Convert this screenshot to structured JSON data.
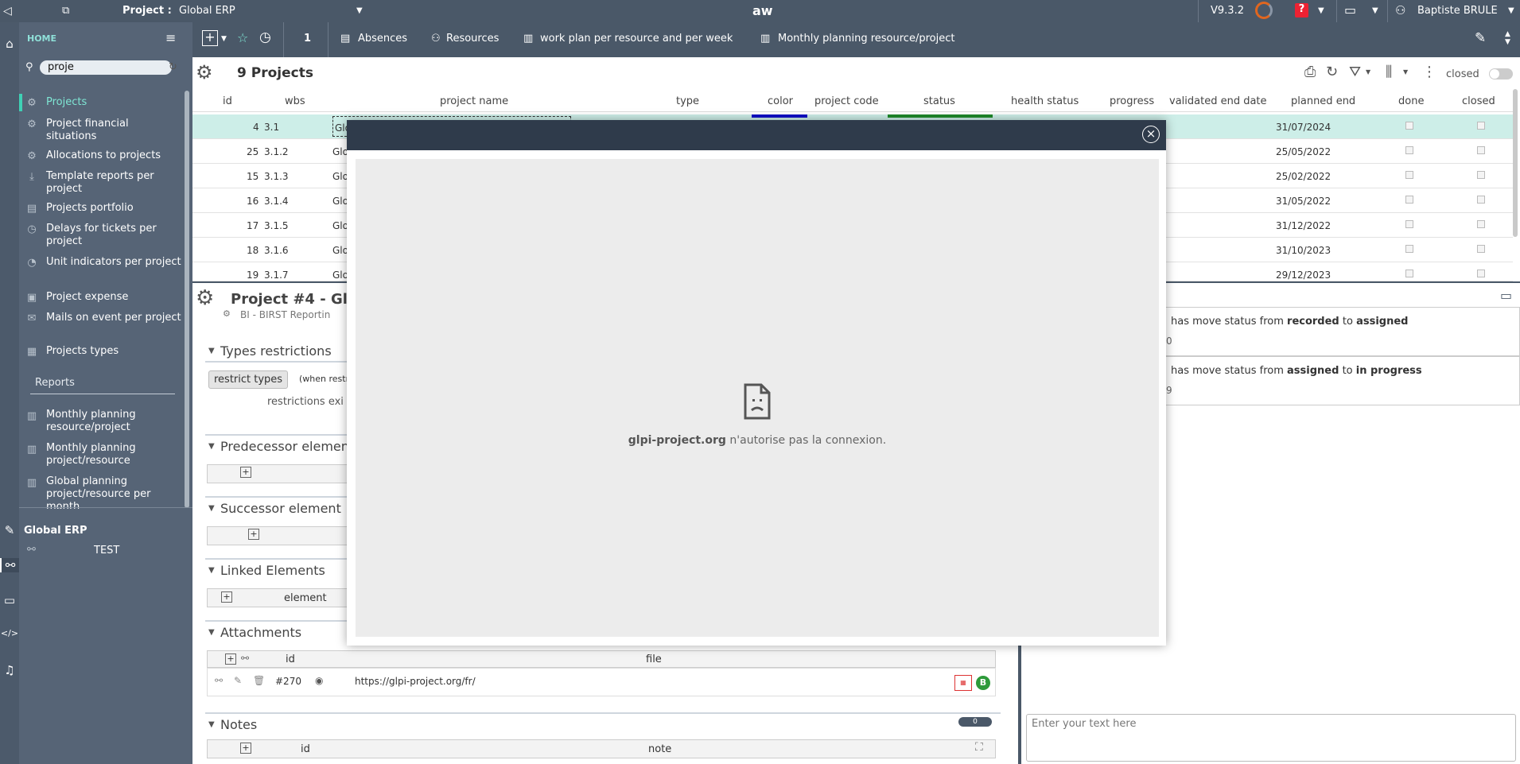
{
  "topbar": {
    "project_label": "Project :",
    "project_value": "Global ERP",
    "center_title": "aw",
    "version": "V9.3.2",
    "user": "Baptiste BRULE"
  },
  "sidebar": {
    "home": "HOME",
    "search_value": "proje",
    "items": [
      {
        "label": "Projects",
        "icon": "gear-icon"
      },
      {
        "label": "Project financial situations",
        "icon": "gear-icon"
      },
      {
        "label": "Allocations to projects",
        "icon": "gear-icon"
      },
      {
        "label": "Template reports per project",
        "icon": "download-icon"
      },
      {
        "label": "Projects portfolio",
        "icon": "portfolio-icon"
      },
      {
        "label": "Delays for tickets per project",
        "icon": "clock-icon"
      },
      {
        "label": "Unit indicators per project",
        "icon": "gauge-icon"
      },
      {
        "label": "Project expense",
        "icon": "expense-icon"
      },
      {
        "label": "Mails on event per project",
        "icon": "mail-icon"
      },
      {
        "label": "Projects types",
        "icon": "types-icon"
      }
    ],
    "reports_header": "Reports",
    "reports": [
      {
        "label": "Monthly planning resource/project"
      },
      {
        "label": "Monthly planning project/resource"
      },
      {
        "label": "Global planning project/resource per month"
      }
    ],
    "footer_project": "Global ERP",
    "footer_sub": "TEST"
  },
  "toolbar": {
    "count": "1",
    "absences": "Absences",
    "resources": "Resources",
    "workplan": "work plan per resource and per week",
    "monthly": "Monthly planning resource/project"
  },
  "list": {
    "title": "9 Projects",
    "closed_label": "closed",
    "columns": [
      "id",
      "wbs",
      "project name",
      "type",
      "color",
      "project code",
      "status",
      "health status",
      "progress",
      "validated end date",
      "planned end",
      "done",
      "closed"
    ],
    "rows": [
      {
        "id": "4",
        "wbs": "3.1",
        "name": "Glo",
        "planned_end": "31/07/2024"
      },
      {
        "id": "25",
        "wbs": "3.1.2",
        "name": "Glo",
        "planned_end": "25/05/2022"
      },
      {
        "id": "15",
        "wbs": "3.1.3",
        "name": "Glo",
        "planned_end": "25/02/2022"
      },
      {
        "id": "16",
        "wbs": "3.1.4",
        "name": "Glo",
        "planned_end": "31/05/2022"
      },
      {
        "id": "17",
        "wbs": "3.1.5",
        "name": "Glo",
        "planned_end": "31/12/2022"
      },
      {
        "id": "18",
        "wbs": "3.1.6",
        "name": "Glo",
        "planned_end": "31/10/2023"
      },
      {
        "id": "19",
        "wbs": "3.1.7",
        "name": "Glo",
        "planned_end": "29/12/2023"
      }
    ]
  },
  "detail": {
    "title": "Project  #4  - Gl",
    "bi_line": "BI - BIRST Reportin",
    "types_restrictions": "Types restrictions",
    "restrict_types": "restrict types",
    "when_restr": "(when restr",
    "restrictions_exi": "restrictions exi",
    "predecessor": "Predecessor elemen",
    "successor": "Successor element",
    "linked": "Linked Elements",
    "linked_col": "element",
    "attachments": "Attachments",
    "att_col_id": "id",
    "att_col_file": "file",
    "att_id": "#270",
    "att_url": "https://glpi-project.org/fr/",
    "notes": "Notes",
    "notes_count": "0",
    "notes_col_id": "id",
    "notes_col_note": "note"
  },
  "history": {
    "line1_prefix": "has move status from",
    "line1_from": "recorded",
    "line1_to_word": "to",
    "line1_to": "assigned",
    "line1_sub": "0",
    "line2_prefix": "has move status from",
    "line2_from": "assigned",
    "line2_to_word": "to",
    "line2_to": "in progress",
    "line2_sub": "9",
    "editor_placeholder": "Enter your text here"
  },
  "modal": {
    "domain": "glpi-project.org",
    "message": "n'autorise pas la connexion."
  }
}
